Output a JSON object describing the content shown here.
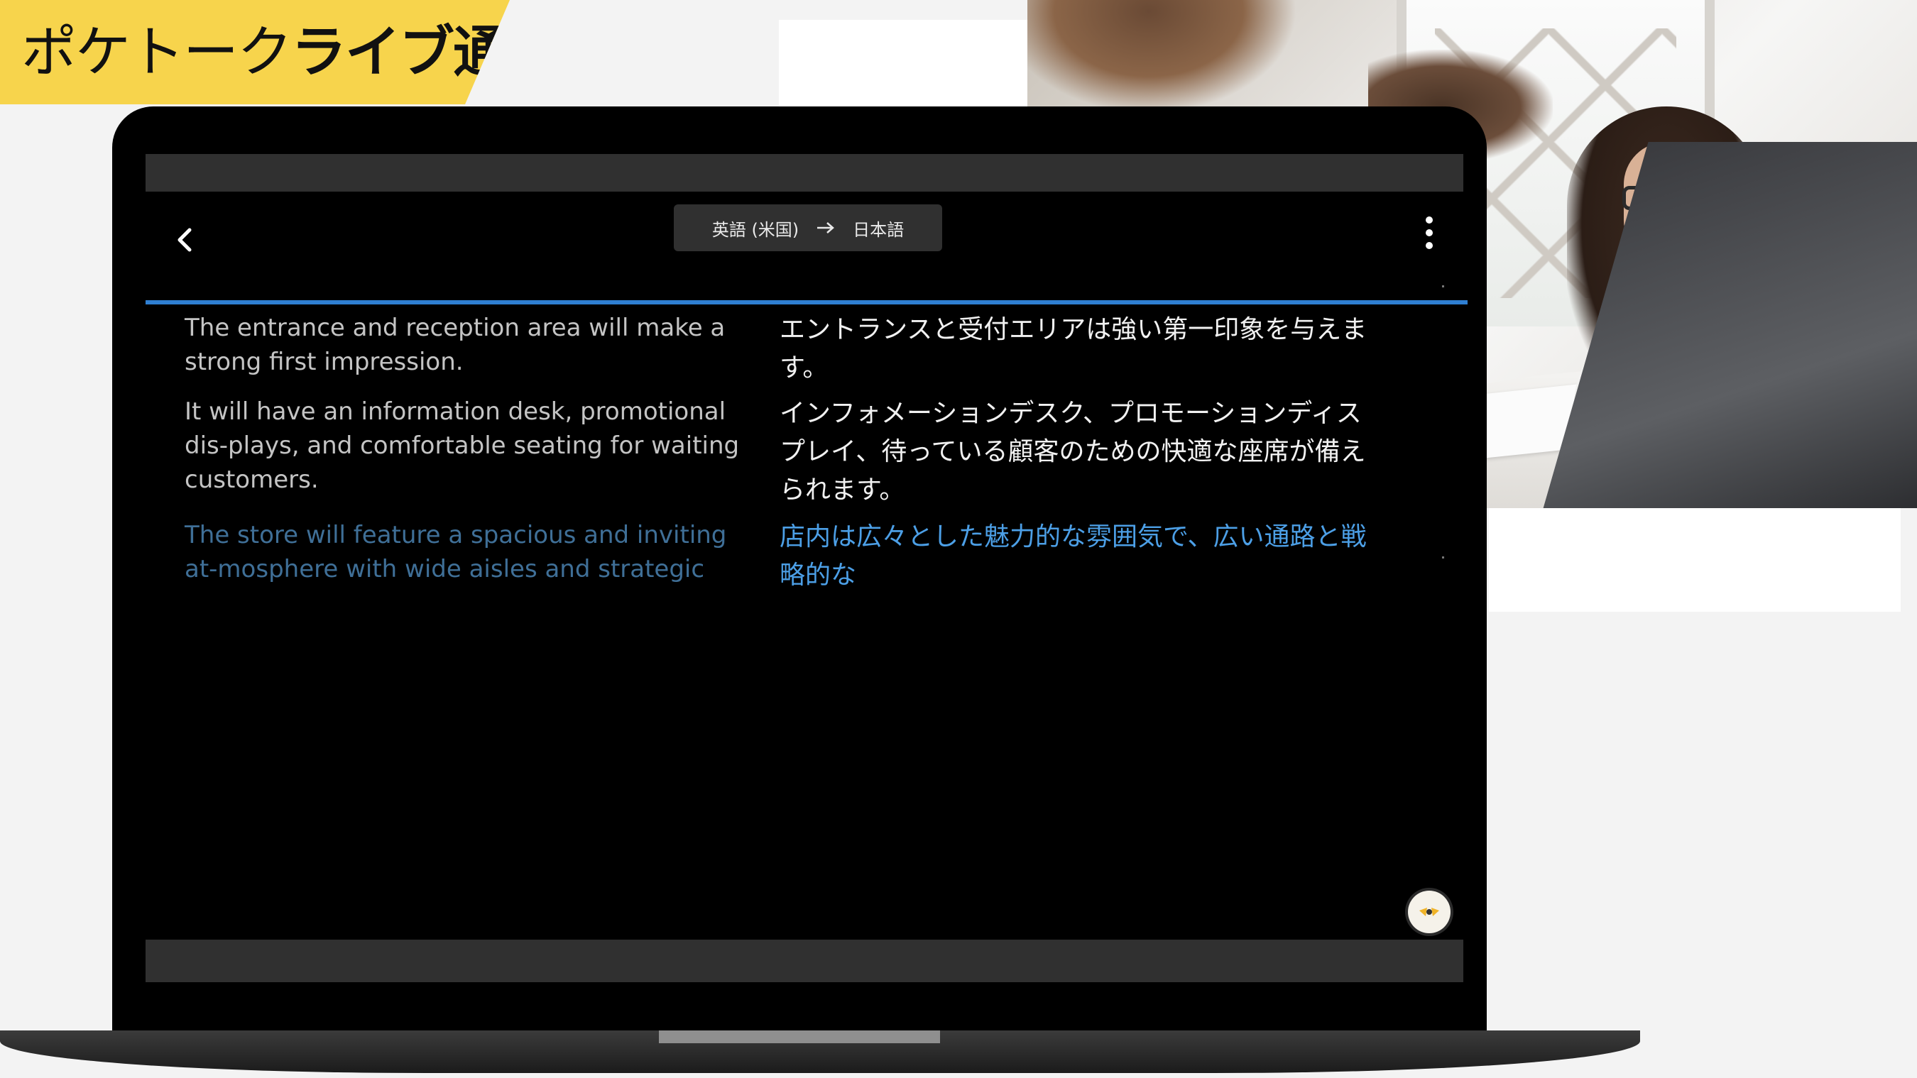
{
  "brand": {
    "title_light": "ポケトーク",
    "title_bold": "ライブ通訳",
    "banner_color": "#f7d44c"
  },
  "header": {
    "back_icon": "chevron-left-icon",
    "source_language": "英語 (米国)",
    "target_language": "日本語",
    "arrow_icon": "arrow-right-icon",
    "menu_icon": "more-vertical-icon"
  },
  "transcript": [
    {
      "source": "The entrance and reception area will make a strong first impression.",
      "target": "エントランスと受付エリアは強い第一印象を与えます。",
      "state": "final"
    },
    {
      "source": "It will have an information desk, promotional dis-plays, and comfortable seating for waiting customers.",
      "target": "インフォメーションデスク、プロモーションディスプレイ、待っている顧客のための快適な座席が備えられます。",
      "state": "final"
    },
    {
      "source": "The store will feature a spacious and inviting at-mosphere with wide aisles and strategic",
      "target": "店内は広々とした魅力的な雰囲気で、広い通路と戦略的な",
      "state": "in-progress"
    }
  ],
  "fab": {
    "icon": "pocketalk-logo-icon"
  },
  "colors": {
    "accent": "#2f7fd2",
    "active_source": "#3f6f97",
    "active_target": "#4c9fe6",
    "bar": "#303030"
  }
}
